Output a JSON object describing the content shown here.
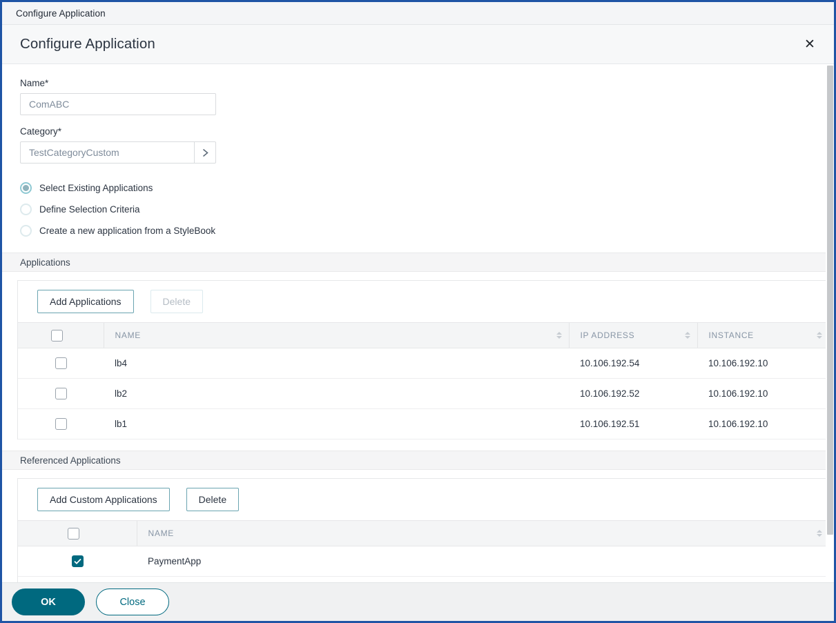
{
  "window": {
    "titlebar_text": "Configure Application"
  },
  "dialog": {
    "title": "Configure Application",
    "close_icon": "close-icon"
  },
  "form": {
    "name": {
      "label": "Name*",
      "value": "ComABC",
      "placeholder": "Name"
    },
    "category": {
      "label": "Category*",
      "value": "TestCategoryCustom",
      "caret_icon": "chevron-right-icon"
    }
  },
  "mode_options": [
    {
      "label": "Select Existing Applications",
      "checked": true
    },
    {
      "label": "Define Selection Criteria",
      "checked": false
    },
    {
      "label": "Create a new application from a StyleBook",
      "checked": false
    }
  ],
  "applications_section": {
    "band_label": "Applications",
    "toolbar": {
      "add_label": "Add Applications",
      "delete_label": "Delete",
      "delete_disabled": true
    },
    "columns": [
      "NAME",
      "IP ADDRESS",
      "INSTANCE"
    ],
    "rows": [
      {
        "checked": false,
        "name": "lb4",
        "ip_address": "10.106.192.54",
        "instance": "10.106.192.10"
      },
      {
        "checked": false,
        "name": "lb2",
        "ip_address": "10.106.192.52",
        "instance": "10.106.192.10"
      },
      {
        "checked": false,
        "name": "lb1",
        "ip_address": "10.106.192.51",
        "instance": "10.106.192.10"
      }
    ],
    "header_checked": false
  },
  "referenced_section": {
    "band_label": "Referenced Applications",
    "toolbar": {
      "add_label": "Add Custom Applications",
      "delete_label": "Delete",
      "delete_disabled": false
    },
    "columns": [
      "NAME"
    ],
    "rows": [
      {
        "checked": true,
        "name": "PaymentApp"
      }
    ],
    "header_checked": false
  },
  "footer": {
    "ok_label": "OK",
    "close_label": "Close"
  },
  "colors": {
    "window_border": "#1f54a5",
    "accent_teal": "#00697f",
    "button_outline_teal": "#6aa4b0",
    "radio_teal": "#8fc9d3",
    "band_gray": "#f5f5f6",
    "footer_gray": "#f0f1f2"
  }
}
